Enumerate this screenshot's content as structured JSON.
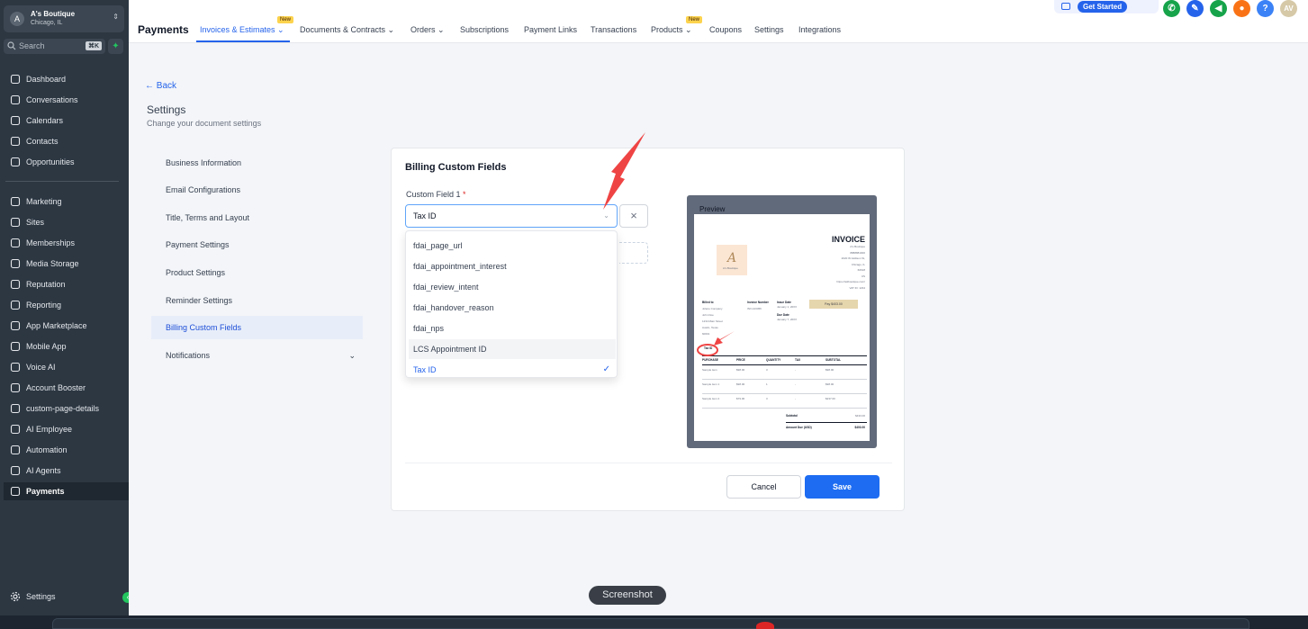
{
  "account": {
    "initials": "A",
    "name": "A's Boutique",
    "location": "Chicago, IL"
  },
  "search": {
    "placeholder": "Search",
    "shortcut": "⌘K"
  },
  "sidebar": {
    "items": [
      {
        "label": "Dashboard",
        "icon": "dashboard-icon"
      },
      {
        "label": "Conversations",
        "icon": "chat-icon"
      },
      {
        "label": "Calendars",
        "icon": "calendar-icon"
      },
      {
        "label": "Contacts",
        "icon": "contacts-icon"
      },
      {
        "label": "Opportunities",
        "icon": "opportunities-icon"
      },
      {
        "label": "Marketing",
        "icon": "send-icon"
      },
      {
        "label": "Sites",
        "icon": "sites-icon"
      },
      {
        "label": "Memberships",
        "icon": "memberships-icon"
      },
      {
        "label": "Media Storage",
        "icon": "media-icon"
      },
      {
        "label": "Reputation",
        "icon": "star-icon"
      },
      {
        "label": "Reporting",
        "icon": "reporting-icon"
      },
      {
        "label": "App Marketplace",
        "icon": "grid-icon"
      },
      {
        "label": "Mobile App",
        "icon": "mobile-icon"
      },
      {
        "label": "Voice AI",
        "icon": "phone-icon"
      },
      {
        "label": "Account Booster",
        "icon": "booster-icon"
      },
      {
        "label": "custom-page-details",
        "icon": "page-icon"
      },
      {
        "label": "AI Employee",
        "icon": "person-icon"
      },
      {
        "label": "Automation",
        "icon": "automation-icon"
      },
      {
        "label": "AI Agents",
        "icon": "sparkle-icon"
      },
      {
        "label": "Payments",
        "icon": "receipt-icon"
      }
    ],
    "settings_label": "Settings"
  },
  "topbar": {
    "title": "Payments",
    "tabs": [
      {
        "label": "Invoices & Estimates"
      },
      {
        "label": "Documents & Contracts"
      },
      {
        "label": "Orders"
      },
      {
        "label": "Subscriptions"
      },
      {
        "label": "Payment Links"
      },
      {
        "label": "Transactions"
      },
      {
        "label": "Products"
      },
      {
        "label": "Coupons"
      },
      {
        "label": "Settings"
      },
      {
        "label": "Integrations"
      }
    ],
    "new_badge": "New",
    "get_started": "Get Started",
    "user_initials": "AV"
  },
  "page": {
    "back": "Back",
    "heading": "Settings",
    "subheading": "Change your document settings",
    "settings_nav": [
      "Business Information",
      "Email Configurations",
      "Title, Terms and Layout",
      "Payment Settings",
      "Product Settings",
      "Reminder Settings",
      "Billing Custom Fields",
      "Notifications"
    ]
  },
  "billing": {
    "title": "Billing Custom Fields",
    "field_label": "Custom Field 1",
    "required_mark": "*",
    "selected": "Tax ID",
    "options": [
      "fdai_page_url",
      "fdai_appointment_interest",
      "fdai_review_intent",
      "fdai_handover_reason",
      "fdai_nps",
      "LCS Appointment ID",
      "Tax ID"
    ],
    "cancel": "Cancel",
    "save": "Save"
  },
  "preview": {
    "label": "Preview",
    "invoice_title": "INVOICE",
    "logo_letter": "A",
    "logo_name": "A's Boutique",
    "biz_lines": [
      "A's Boutique",
      "8888881000",
      "2020 W Addison St,",
      "Chicago, IL",
      "60618",
      "US",
      "https://aslboutique.com/",
      "VAT ID: 1234"
    ],
    "billed_to_label": "Billed to",
    "billed_to_lines": [
      "Jolene Company",
      "John Doe",
      "1234 Main Street",
      "Austin, Texas",
      "60601"
    ],
    "invoice_number_label": "Invoice Number",
    "invoice_number": "INV-123456",
    "issue_date_label": "Issue Date",
    "issue_date": "January 1, 20XX",
    "due_date_label": "Due Date",
    "due_date": "January 7, 20XX",
    "pay_button": "Pay $403.00",
    "custom_field_tag": "Tax ID",
    "columns": [
      "PURCHASE",
      "PRICE",
      "QUANTITY",
      "TAX",
      "SUBTOTAL"
    ],
    "rows": [
      {
        "item": "Sample item",
        "price": "$98.00",
        "qty": "3",
        "tax": "-",
        "subtotal": "$98.00"
      },
      {
        "item": "Sample item 1",
        "price": "$98.00",
        "qty": "1",
        "tax": "-",
        "subtotal": "$98.00"
      },
      {
        "item": "Sample item 2",
        "price": "$79.00",
        "qty": "3",
        "tax": "-",
        "subtotal": "$237.00"
      }
    ],
    "subtotal_label": "Subtotal",
    "subtotal": "$433.00",
    "amount_due_label": "Amount Due (USD)",
    "amount_due": "$403.00"
  },
  "overlay": {
    "tooltip": "Screenshot"
  },
  "colors": {
    "accent": "#2563eb",
    "sidebar": "#2c3742",
    "annotation": "#ef4444",
    "save": "#1d6cf2"
  }
}
